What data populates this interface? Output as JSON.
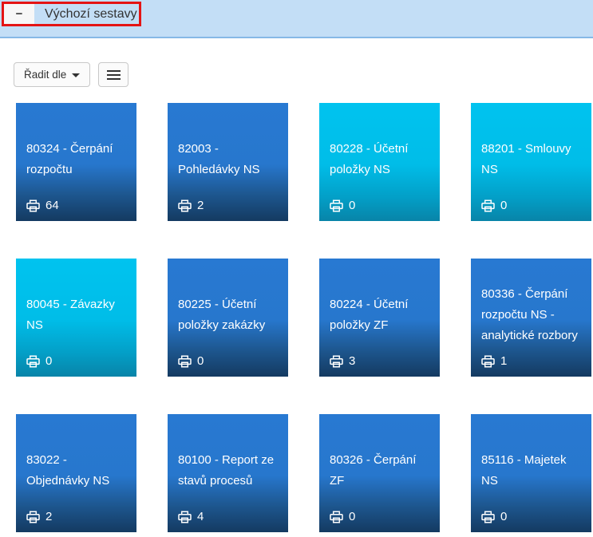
{
  "header": {
    "collapse_label": "−",
    "title": "Výchozí sestavy"
  },
  "toolbar": {
    "sort_label": "Řadit dle",
    "menu_icon": "hamburger",
    "sort_caret_icon": "caret-down"
  },
  "colors": {
    "header_bg": "#c3def6",
    "header_border": "#86b8e6",
    "annotation_red": "#e41414",
    "tile_blue_top": "#2879d2",
    "tile_blue_bottom": "#143a61",
    "tile_cyan_top": "#00c3ef",
    "tile_cyan_bottom": "#0884a8",
    "tile_text": "#ffffff"
  },
  "tiles": [
    {
      "title": "80324 - Čerpání rozpočtu",
      "count": "64",
      "variant": "blue"
    },
    {
      "title": "82003 - Pohledávky NS",
      "count": "2",
      "variant": "blue"
    },
    {
      "title": "80228 - Účetní položky NS",
      "count": "0",
      "variant": "cyan"
    },
    {
      "title": "88201 - Smlouvy NS",
      "count": "0",
      "variant": "cyan"
    },
    {
      "title": "80045 - Závazky NS",
      "count": "0",
      "variant": "cyan"
    },
    {
      "title": "80225 - Účetní položky zakázky",
      "count": "0",
      "variant": "blue"
    },
    {
      "title": "80224 - Účetní položky ZF",
      "count": "3",
      "variant": "blue"
    },
    {
      "title": "80336 - Čerpání rozpočtu NS - analytické rozbory",
      "count": "1",
      "variant": "blue"
    },
    {
      "title": "83022 - Objednávky NS",
      "count": "2",
      "variant": "blue"
    },
    {
      "title": "80100 - Report ze stavů procesů",
      "count": "4",
      "variant": "blue"
    },
    {
      "title": "80326 - Čerpání ZF",
      "count": "0",
      "variant": "blue"
    },
    {
      "title": "85116 - Majetek NS",
      "count": "0",
      "variant": "blue"
    }
  ]
}
